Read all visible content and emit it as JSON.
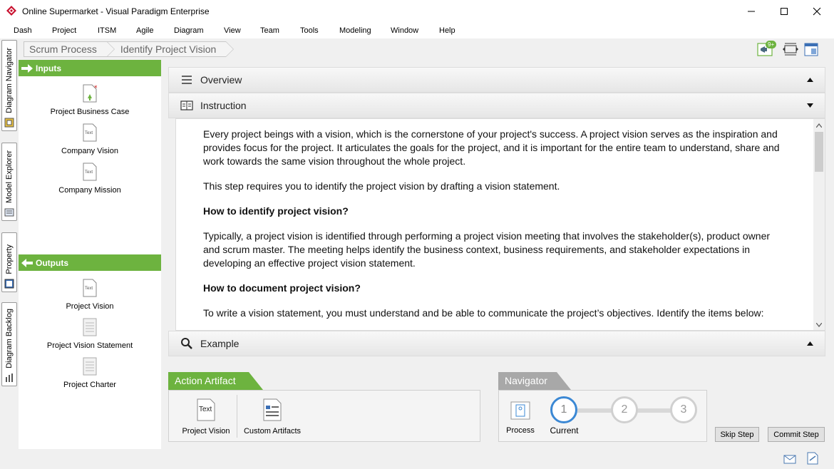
{
  "window": {
    "title": "Online Supermarket - Visual Paradigm Enterprise"
  },
  "menu": [
    "Dash",
    "Project",
    "ITSM",
    "Agile",
    "Diagram",
    "View",
    "Team",
    "Tools",
    "Modeling",
    "Window",
    "Help"
  ],
  "side_tabs": [
    "Diagram Navigator",
    "Model Explorer",
    "Property",
    "Diagram Backlog"
  ],
  "breadcrumb": [
    "Scrum Process",
    "Identify Project Vision"
  ],
  "toolbar": {
    "notification_badge": "9+"
  },
  "inputs": {
    "header": "Inputs",
    "items": [
      "Project Business Case",
      "Company Vision",
      "Company Mission"
    ]
  },
  "outputs": {
    "header": "Outputs",
    "items": [
      "Project Vision",
      "Project Vision Statement",
      "Project Charter"
    ]
  },
  "accordion": {
    "overview": "Overview",
    "instruction": "Instruction",
    "example": "Example"
  },
  "instruction_content": {
    "p1": "Every project beings with a vision, which is the cornerstone of your project's success. A project vision serves as the inspiration and provides focus for the project. It articulates the goals for the project, and it is important for the entire team to understand, share and work towards the same vision throughout the whole project.",
    "p2": "This step requires you to identify the project vision by drafting a vision statement.",
    "h1": "How to identify project vision?",
    "p3": "Typically, a project vision is identified through performing a project vision meeting that involves the stakeholder(s), product owner and scrum master. The meeting helps identify the business context, business requirements, and stakeholder expectations in developing an effective project vision statement.",
    "h2": "How to document project vision?",
    "p4": "To write a vision statement, you must understand and be able to communicate the project’s objectives. Identify the items below:"
  },
  "action_artifact": {
    "header": "Action Artifact",
    "items": [
      "Project Vision",
      "Custom Artifacts"
    ],
    "icon_text": "Text"
  },
  "navigator": {
    "header": "Navigator",
    "process_label": "Process",
    "current_label": "Current",
    "steps": [
      "1",
      "2",
      "3"
    ]
  },
  "buttons": {
    "skip": "Skip Step",
    "commit": "Commit Step"
  },
  "icon_text": "Text"
}
